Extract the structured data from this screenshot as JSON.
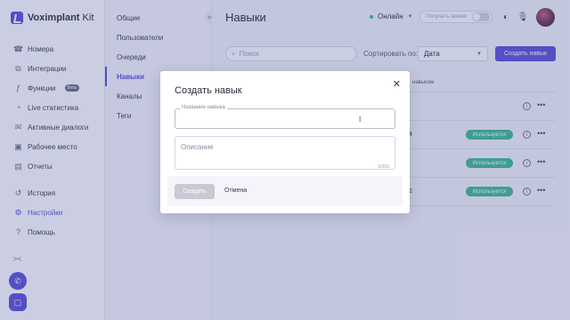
{
  "app": {
    "logo_text_bold": "Voximplant",
    "logo_text": " Kit"
  },
  "sidebar": {
    "items": [
      {
        "label": "Номера",
        "icon": "phone-book-icon"
      },
      {
        "label": "Интеграции",
        "icon": "puzzle-icon"
      },
      {
        "label": "Функции",
        "icon": "function-icon",
        "badge": "Beta"
      },
      {
        "label": "Live статистика",
        "icon": "pulse-icon"
      },
      {
        "label": "Активные диалоги",
        "icon": "chat-icon"
      },
      {
        "label": "Рабочее место",
        "icon": "workplace-icon"
      },
      {
        "label": "Отчеты",
        "icon": "report-icon"
      }
    ],
    "bottom_items": [
      {
        "label": "История",
        "icon": "history-icon"
      },
      {
        "label": "Настройки",
        "icon": "settings-icon",
        "active": true
      },
      {
        "label": "Помощь",
        "icon": "help-icon"
      }
    ]
  },
  "submenu": {
    "items": [
      "Общие",
      "Пользователи",
      "Очереди",
      "Навыки",
      "Каналы",
      "Теги"
    ],
    "active": "Навыки"
  },
  "header": {
    "title": "Навыки",
    "status": "Онлайн",
    "status_color": "#3dbb8f",
    "calls_toggle_label": "Получать звонки"
  },
  "toolbar": {
    "search_placeholder": "Поиск",
    "sort_label": "Сортировать по:",
    "sort_value": "Дата",
    "create_button": "Создать навык"
  },
  "table": {
    "header_partial": "навыком",
    "rows": [
      {
        "name_partial": "",
        "badge": ""
      },
      {
        "name_partial": "4",
        "badge": "Используется"
      },
      {
        "name_partial": "",
        "badge": "Используется"
      },
      {
        "name_partial": "2",
        "badge": "Используется"
      }
    ]
  },
  "modal": {
    "title": "Создать навык",
    "name_label": "Название навыка",
    "name_value": "",
    "description_placeholder": "Описание",
    "description_counter": "0/200",
    "create_button": "Создать",
    "cancel_button": "Отмена"
  },
  "colors": {
    "accent": "#5b4fd6",
    "success": "#3dbb8f",
    "overlay": "rgba(70,80,150,0.28)"
  }
}
